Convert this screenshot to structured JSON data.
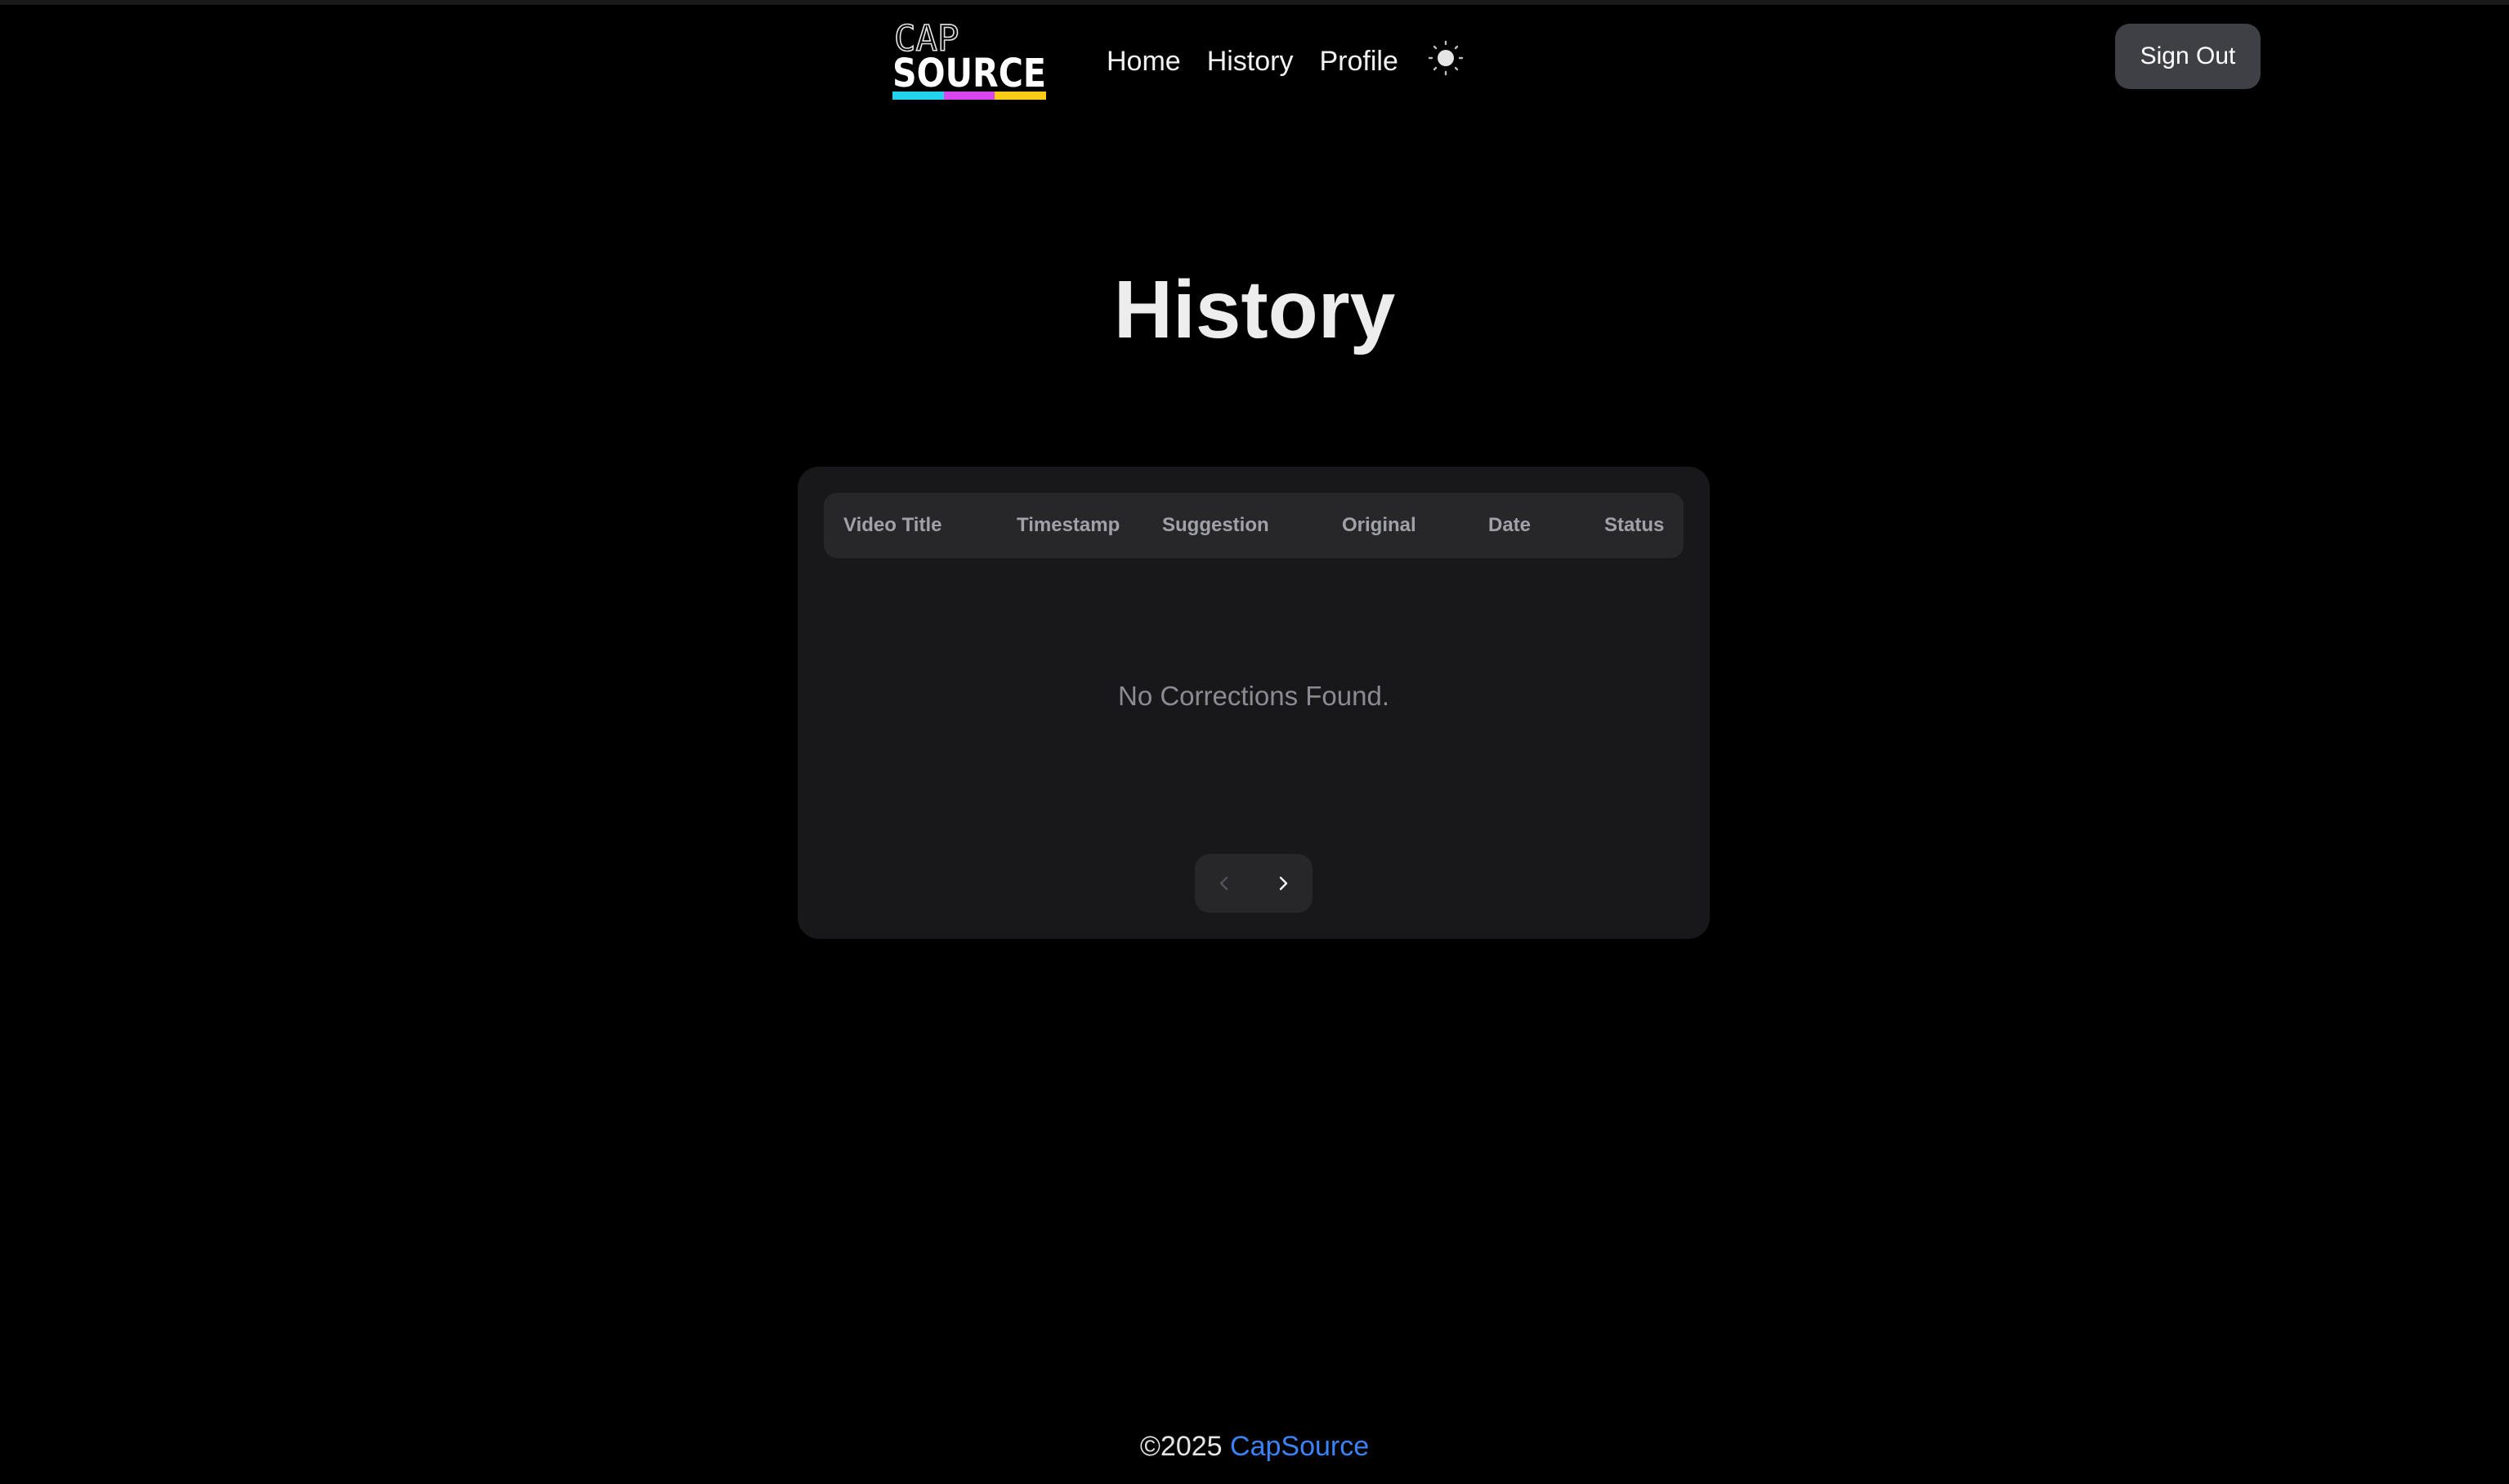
{
  "header": {
    "logo": {
      "line1": "CAP",
      "line2": "SOURCE",
      "stripe_colors": [
        "#22d3ee",
        "#d946ef",
        "#facc15"
      ]
    },
    "nav": [
      {
        "label": "Home"
      },
      {
        "label": "History"
      },
      {
        "label": "Profile"
      }
    ],
    "theme_toggle_icon": "sun-icon",
    "sign_out_label": "Sign Out"
  },
  "main": {
    "title": "History",
    "table": {
      "columns": [
        "Video Title",
        "Timestamp",
        "Suggestion",
        "Original",
        "Date",
        "Status"
      ],
      "empty_message": "No Corrections Found."
    },
    "pagination": {
      "prev_icon": "chevron-left-icon",
      "next_icon": "chevron-right-icon"
    }
  },
  "footer": {
    "copyright": "©2025",
    "brand_link": "CapSource",
    "link_color": "#3b82f6"
  }
}
